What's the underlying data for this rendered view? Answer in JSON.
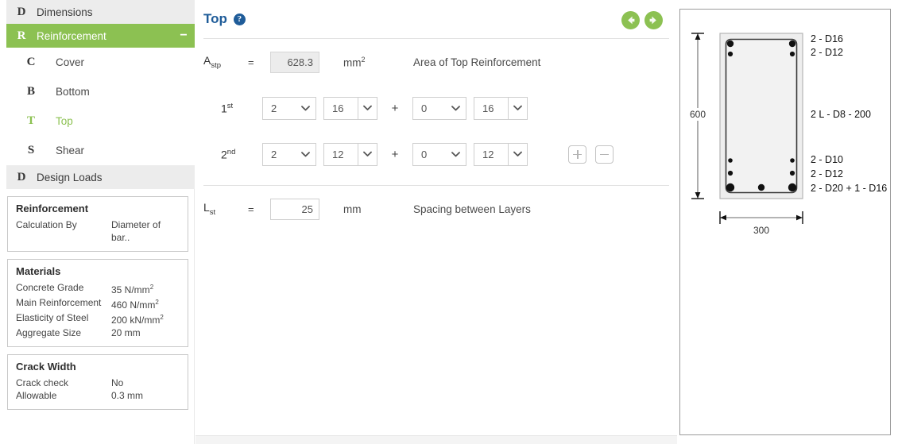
{
  "sidebar": {
    "groups": [
      {
        "badge": "D",
        "label": "Dimensions",
        "active": false,
        "collapse": ""
      },
      {
        "badge": "R",
        "label": "Reinforcement",
        "active": true,
        "collapse": "−"
      }
    ],
    "sub_items": [
      {
        "badge": "C",
        "label": "Cover",
        "selected": false
      },
      {
        "badge": "B",
        "label": "Bottom",
        "selected": false
      },
      {
        "badge": "T",
        "label": "Top",
        "selected": true
      },
      {
        "badge": "S",
        "label": "Shear",
        "selected": false
      }
    ],
    "design_loads": {
      "badge": "D",
      "label": "Design Loads"
    },
    "cards": [
      {
        "title": "Reinforcement",
        "rows": [
          {
            "key": "Calculation By",
            "value": "Diameter of bar.."
          }
        ]
      },
      {
        "title": "Materials",
        "rows": [
          {
            "key": "Concrete Grade",
            "value": "35 N/mm",
            "sup": "2"
          },
          {
            "key": "Main Reinforcement",
            "value": "460 N/mm",
            "sup": "2"
          },
          {
            "key": "Elasticity of Steel",
            "value": "200 kN/mm",
            "sup": "2"
          },
          {
            "key": "Aggregate Size",
            "value": "20 mm",
            "sup": ""
          }
        ]
      },
      {
        "title": "Crack Width",
        "rows": [
          {
            "key": "Crack check",
            "value": "No",
            "sup": ""
          },
          {
            "key": "Allowable",
            "value": "0.3 mm",
            "sup": ""
          }
        ]
      }
    ]
  },
  "main": {
    "title": "Top",
    "help_tooltip": "?",
    "prev_label": "Previous",
    "next_label": "Next",
    "area_field": {
      "symbol": "A",
      "subscript": "stp",
      "equals": "=",
      "value": "628.3",
      "unit": "mm",
      "unit_sup": "2",
      "description": "Area of Top Reinforcement"
    },
    "bar_rows": [
      {
        "ordinal": "1",
        "ordinal_sup": "st",
        "count1": "2",
        "dia1": "16",
        "operator": "+",
        "count2": "0",
        "dia2": "16"
      },
      {
        "ordinal": "2",
        "ordinal_sup": "nd",
        "count1": "2",
        "dia1": "12",
        "operator": "+",
        "count2": "0",
        "dia2": "12"
      }
    ],
    "add_layer_label": "+",
    "remove_layer_label": "−",
    "spacing_field": {
      "symbol": "L",
      "subscript": "st",
      "equals": "=",
      "value": "25",
      "unit": "mm",
      "description": "Spacing between Layers"
    }
  },
  "diagram": {
    "depth_label": "600",
    "width_label": "300",
    "top_annotations": [
      "2 - D16",
      "2 - D12"
    ],
    "side_annotation": "2 L - D8 - 200",
    "bottom_annotations": [
      "2 - D10",
      "2 - D12",
      "2 - D20 + 1 - D16"
    ]
  },
  "colors": {
    "accent_green": "#8cc152",
    "title_blue": "#1f5c99",
    "header_gray": "#ececec"
  }
}
